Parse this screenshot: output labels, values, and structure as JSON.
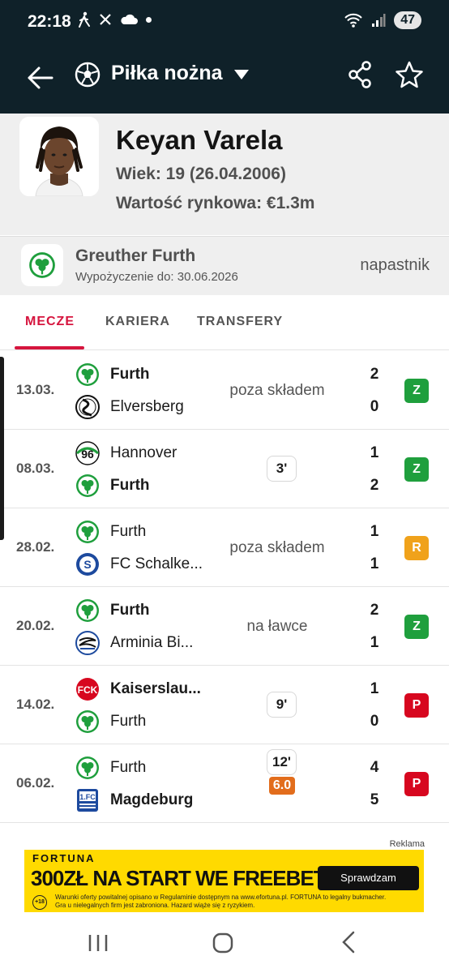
{
  "status_bar": {
    "time": "22:18",
    "battery": "47"
  },
  "app_bar": {
    "sport": "Piłka nożna"
  },
  "player": {
    "name": "Keyan Varela",
    "age": "Wiek: 19 (26.04.2006)",
    "market_value": "Wartość rynkowa: €1.3m"
  },
  "club": {
    "name": "Greuther Furth",
    "loan": "Wypożyczenie do: 30.06.2026",
    "position": "napastnik"
  },
  "tabs": [
    {
      "label": "MECZE",
      "active": true
    },
    {
      "label": "KARIERA",
      "active": false
    },
    {
      "label": "TRANSFERY",
      "active": false
    }
  ],
  "matches": [
    {
      "date": "13.03.",
      "home": {
        "name": "Furth",
        "bold": true,
        "logo": "furth-logo-icon",
        "score": "2"
      },
      "away": {
        "name": "Elversberg",
        "bold": false,
        "logo": "elversberg-logo-icon",
        "score": "0"
      },
      "status": "poza składem",
      "minutes": "",
      "rating": "",
      "result": "Z",
      "result_type": "win"
    },
    {
      "date": "08.03.",
      "home": {
        "name": "Hannover",
        "bold": false,
        "logo": "hannover-logo-icon",
        "score": "1"
      },
      "away": {
        "name": "Furth",
        "bold": true,
        "logo": "furth-logo-icon",
        "score": "2"
      },
      "status": "",
      "minutes": "3'",
      "rating": "",
      "result": "Z",
      "result_type": "win"
    },
    {
      "date": "28.02.",
      "home": {
        "name": "Furth",
        "bold": false,
        "logo": "furth-logo-icon",
        "score": "1"
      },
      "away": {
        "name": "FC Schalke...",
        "bold": false,
        "logo": "schalke-logo-icon",
        "score": "1"
      },
      "status": "poza składem",
      "minutes": "",
      "rating": "",
      "result": "R",
      "result_type": "draw"
    },
    {
      "date": "20.02.",
      "home": {
        "name": "Furth",
        "bold": true,
        "logo": "furth-logo-icon",
        "score": "2"
      },
      "away": {
        "name": "Arminia Bi...",
        "bold": false,
        "logo": "arminia-logo-icon",
        "score": "1"
      },
      "status": "na ławce",
      "minutes": "",
      "rating": "",
      "result": "Z",
      "result_type": "win"
    },
    {
      "date": "14.02.",
      "home": {
        "name": "Kaiserslau...",
        "bold": true,
        "logo": "kaiserslautern-logo-icon",
        "score": "1"
      },
      "away": {
        "name": "Furth",
        "bold": false,
        "logo": "furth-logo-icon",
        "score": "0"
      },
      "status": "",
      "minutes": "9'",
      "rating": "",
      "result": "P",
      "result_type": "loss"
    },
    {
      "date": "06.02.",
      "home": {
        "name": "Furth",
        "bold": false,
        "logo": "furth-logo-icon",
        "score": "4"
      },
      "away": {
        "name": "Magdeburg",
        "bold": true,
        "logo": "magdeburg-logo-icon",
        "score": "5"
      },
      "status": "",
      "minutes": "12'",
      "rating": "6.0",
      "result": "P",
      "result_type": "loss"
    }
  ],
  "ad": {
    "label": "Reklama",
    "brand": "FORTUNA",
    "headline": "300ZŁ NA START WE FREEBETACH",
    "cta": "Sprawdzam",
    "age_badge": "+18",
    "disclaimer": "Warunki oferty powitalnej opisano w Regulaminie dostępnym na www.efortuna.pl. FORTUNA to legalny bukmacher. Gra u nielegalnych firm jest zabroniona. Hazard wiąże się z ryzykiem."
  },
  "colors": {
    "header_bg": "#0f2129",
    "accent": "#d6153e",
    "win": "#1f9f3d",
    "draw": "#f0a21b",
    "loss": "#d7071f",
    "rating": "#e26d1c"
  }
}
